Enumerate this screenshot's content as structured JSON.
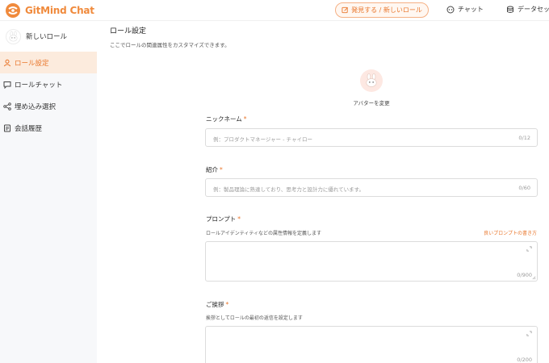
{
  "brand": {
    "name": "GitMind Chat"
  },
  "topbar": {
    "new_role_label": "発見する / 新しいロール",
    "chat_label": "チャット",
    "dataset_label": "データセッ"
  },
  "sidebar": {
    "role_name": "新しいロール",
    "items": [
      {
        "label": "ロール設定",
        "icon": "user-icon",
        "active": true
      },
      {
        "label": "ロールチャット",
        "icon": "chat-bubble-icon",
        "active": false
      },
      {
        "label": "埋め込み選択",
        "icon": "share-nodes-icon",
        "active": false
      },
      {
        "label": "会話履歴",
        "icon": "document-icon",
        "active": false
      }
    ]
  },
  "main": {
    "title": "ロール設定",
    "subtitle": "ここでロールの関連属性をカスタマイズできます。",
    "avatar_change_label": "アバターを変更",
    "fields": {
      "nickname": {
        "label": "ニックネーム",
        "required_mark": "*",
        "placeholder": "例：プロダクトマネージャー - チャイロー",
        "counter": "0/12"
      },
      "intro": {
        "label": "紹介",
        "required_mark": "*",
        "placeholder": "例：製品理論に熟達しており、思考力と設計力に優れています。",
        "counter": "0/60"
      },
      "prompt": {
        "label": "プロンプト",
        "required_mark": "*",
        "help": "ロールアイデンティティなどの属性情報を定義します",
        "link": "良いプロンプトの書き方",
        "counter": "0/900"
      },
      "greeting": {
        "label": "ご挨拶",
        "required_mark": "*",
        "help": "挨拶としてロールの最初の返信を設定します",
        "counter": "0/200"
      }
    }
  },
  "colors": {
    "accent": "#e9762b",
    "active_bg": "#fcebdd",
    "sidebar_bg": "#f7f8fa"
  }
}
